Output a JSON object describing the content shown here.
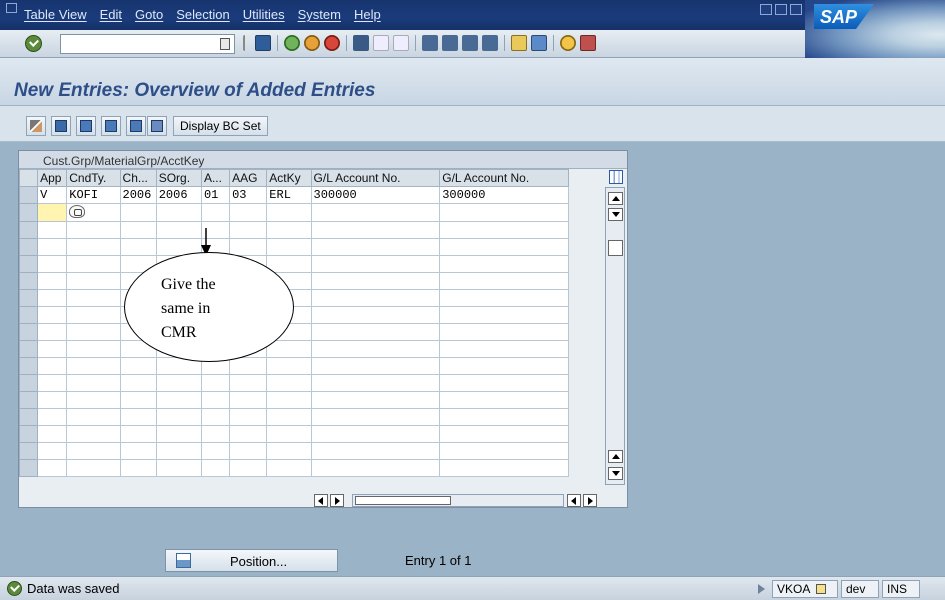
{
  "menubar": {
    "items": [
      "Table View",
      "Edit",
      "Goto",
      "Selection",
      "Utilities",
      "System",
      "Help"
    ]
  },
  "logo": "SAP",
  "toolbar": {
    "command_value": ""
  },
  "page_title": "New Entries: Overview of Added Entries",
  "app_toolbar": {
    "display_bc_set": "Display BC Set"
  },
  "table": {
    "title": "Cust.Grp/MaterialGrp/AcctKey",
    "columns": [
      "App",
      "CndTy.",
      "Ch...",
      "SOrg.",
      "A...",
      "AAG",
      "ActKy",
      "G/L Account No.",
      "G/L Account No."
    ],
    "rows": [
      [
        "V",
        "KOFI",
        "2006",
        "2006",
        "01",
        "03",
        "ERL",
        "300000",
        "300000"
      ]
    ],
    "empty_rows": 16
  },
  "callout": {
    "text_lines": [
      "Give the",
      "same in",
      "CMR"
    ]
  },
  "position_button": "Position...",
  "entry_count": "Entry 1 of 1",
  "status": {
    "message": "Data was saved",
    "transaction": "VKOA",
    "system": "dev",
    "mode": "INS"
  },
  "colors": {
    "title": "#2e4e87",
    "menubar": "#1a3b7c",
    "background": "#9bb3c6"
  }
}
